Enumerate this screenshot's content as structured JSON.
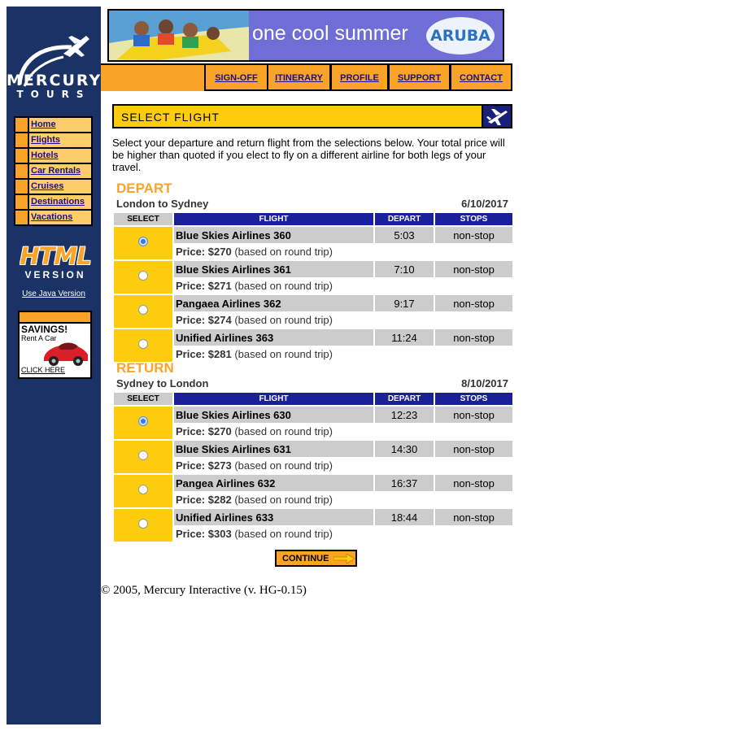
{
  "brand": {
    "name": "MERCURY",
    "sub": "TOURS"
  },
  "sidebar_nav": [
    {
      "label": "Home"
    },
    {
      "label": "Flights"
    },
    {
      "label": "Hotels"
    },
    {
      "label": "Car Rentals"
    },
    {
      "label": "Cruises"
    },
    {
      "label": "Destinations"
    },
    {
      "label": "Vacations"
    }
  ],
  "html_version": {
    "word": "HTML",
    "version": "VERSION",
    "java_link": "Use Java Version"
  },
  "ad": {
    "savings": "SAVINGS!",
    "rent": "Rent A Car",
    "click": "CLICK HERE"
  },
  "banner": {
    "text": "one cool summer",
    "badge": "ARUBA"
  },
  "top_nav": [
    {
      "label": "SIGN-OFF"
    },
    {
      "label": "ITINERARY"
    },
    {
      "label": "PROFILE"
    },
    {
      "label": "SUPPORT"
    },
    {
      "label": "CONTACT"
    }
  ],
  "section_title": "SELECT FLIGHT",
  "intro": "Select your departure and return flight from the selections below. Your total price will be higher than quoted if you elect to fly on a different airline for both legs of your travel.",
  "columns": {
    "select": "SELECT",
    "flight": "FLIGHT",
    "depart": "DEPART",
    "stops": "STOPS"
  },
  "price_prefix": "Price:",
  "price_suffix": "(based on round trip)",
  "depart": {
    "title": "DEPART",
    "route": "London to Sydney",
    "date": "6/10/2017",
    "flights": [
      {
        "name": "Blue Skies Airlines 360",
        "time": "5:03",
        "stops": "non-stop",
        "price": "$270",
        "selected": true
      },
      {
        "name": "Blue Skies Airlines 361",
        "time": "7:10",
        "stops": "non-stop",
        "price": "$271",
        "selected": false
      },
      {
        "name": "Pangaea Airlines 362",
        "time": "9:17",
        "stops": "non-stop",
        "price": "$274",
        "selected": false
      },
      {
        "name": "Unified Airlines 363",
        "time": "11:24",
        "stops": "non-stop",
        "price": "$281",
        "selected": false
      }
    ]
  },
  "return": {
    "title": "RETURN",
    "route": "Sydney to London",
    "date": "8/10/2017",
    "flights": [
      {
        "name": "Blue Skies Airlines 630",
        "time": "12:23",
        "stops": "non-stop",
        "price": "$270",
        "selected": true
      },
      {
        "name": "Blue Skies Airlines 631",
        "time": "14:30",
        "stops": "non-stop",
        "price": "$273",
        "selected": false
      },
      {
        "name": "Pangea Airlines 632",
        "time": "16:37",
        "stops": "non-stop",
        "price": "$282",
        "selected": false
      },
      {
        "name": "Unified Airlines 633",
        "time": "18:44",
        "stops": "non-stop",
        "price": "$303",
        "selected": false
      }
    ]
  },
  "continue_label": "CONTINUE",
  "footer": "© 2005, Mercury Interactive (v. HG-0.15)",
  "colors": {
    "sidebar": "#1a3266",
    "accent": "#f9a428",
    "yellow": "#fccc0d",
    "header_blue": "#1a1f9a",
    "link": "#1c0e8a"
  }
}
